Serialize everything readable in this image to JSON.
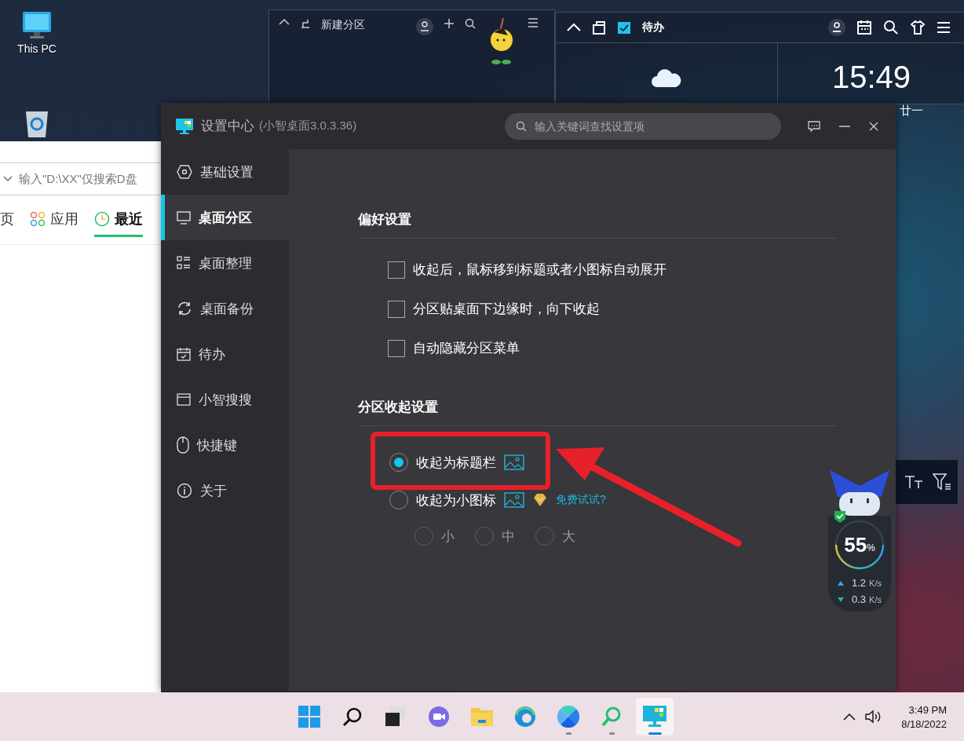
{
  "desktop_icons": [
    {
      "kind": "computer",
      "label": "This PC"
    },
    {
      "kind": "recycle-bin"
    }
  ],
  "partitions": [
    {
      "title": "新建分区"
    },
    {
      "title": "待办"
    }
  ],
  "clock_widget": {
    "time": "15:49",
    "lunar_date": "廿一"
  },
  "search_panel": {
    "placeholder": "输入\"D:\\XX\"仅搜索D盘",
    "tabs": [
      {
        "label": "页",
        "kind": "page",
        "selected": false
      },
      {
        "label": "应用",
        "kind": "apps",
        "selected": false
      },
      {
        "label": "最近",
        "kind": "recent",
        "selected": true
      }
    ]
  },
  "settings": {
    "title": "设置中心",
    "version": "(小智桌面3.0.3.36)",
    "search_placeholder": "输入关键词查找设置项",
    "nav": [
      {
        "label": "基础设置",
        "kind": "hexagon",
        "selected": false
      },
      {
        "label": "桌面分区",
        "kind": "monitor",
        "selected": true
      },
      {
        "label": "桌面整理",
        "kind": "list",
        "selected": false
      },
      {
        "label": "桌面备份",
        "kind": "sync",
        "selected": false
      },
      {
        "label": "待办",
        "kind": "calendar",
        "selected": false
      },
      {
        "label": "小智搜搜",
        "kind": "window",
        "selected": false
      },
      {
        "label": "快捷键",
        "kind": "mouse",
        "selected": false
      },
      {
        "label": "关于",
        "kind": "info",
        "selected": false
      }
    ],
    "preferences": {
      "heading": "偏好设置",
      "options": [
        {
          "label": "收起后，鼠标移到标题或者小图标自动展开",
          "checked": false
        },
        {
          "label": "分区贴桌面下边缘时，向下收起",
          "checked": false
        },
        {
          "label": "自动隐藏分区菜单",
          "checked": false
        }
      ]
    },
    "collapse": {
      "heading": "分区收起设置",
      "modes": [
        {
          "label": "收起为标题栏",
          "selected": true
        },
        {
          "label": "收起为小图标",
          "selected": false,
          "badge": "免费试试?"
        }
      ],
      "sizes": [
        {
          "label": "小",
          "selected": false,
          "disabled": true
        },
        {
          "label": "中",
          "selected": false,
          "disabled": true
        },
        {
          "label": "大",
          "selected": false,
          "disabled": true
        }
      ]
    }
  },
  "monitor_widget": {
    "usage": "55",
    "unit": "%",
    "upload": "1.2",
    "upload_unit": "K/s",
    "download": "0.3",
    "download_unit": "K/s"
  },
  "taskbar": {
    "apps": [
      {
        "kind": "start",
        "running": false,
        "active": false
      },
      {
        "kind": "search",
        "running": false,
        "active": false
      },
      {
        "kind": "task-view",
        "running": false,
        "active": false
      },
      {
        "kind": "chat",
        "running": false,
        "active": false
      },
      {
        "kind": "folder",
        "running": false,
        "active": false
      },
      {
        "kind": "browser",
        "running": false,
        "active": false
      },
      {
        "kind": "petal",
        "running": true,
        "active": false
      },
      {
        "kind": "magnifier",
        "running": true,
        "active": false
      },
      {
        "kind": "desktop-app",
        "running": true,
        "active": true
      }
    ],
    "time": "3:49 PM",
    "date": "8/18/2022"
  }
}
